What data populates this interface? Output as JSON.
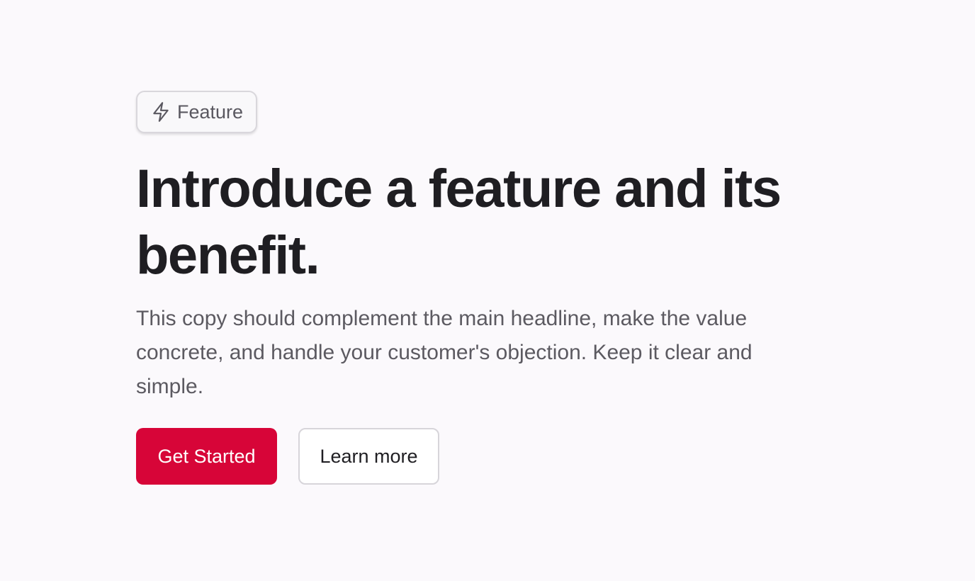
{
  "badge": {
    "icon": "lightning-bolt-icon",
    "label": "Feature"
  },
  "headline": "Introduce a feature and its benefit.",
  "subcopy": "This copy should complement the main headline, make the value concrete, and handle your customer's objection. Keep it clear and simple.",
  "actions": {
    "primary_label": "Get Started",
    "secondary_label": "Learn more"
  },
  "colors": {
    "background": "#fbf9fc",
    "primary_button": "#d70538",
    "headline_text": "#1f1e22",
    "body_text": "#5c5a61"
  }
}
